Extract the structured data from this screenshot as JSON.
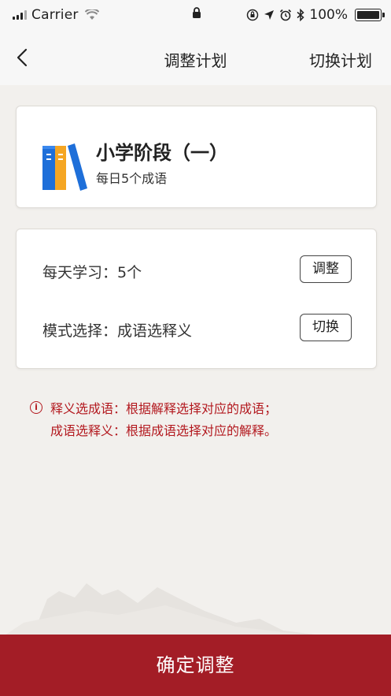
{
  "status_bar": {
    "carrier": "Carrier",
    "battery": "100%",
    "icons": [
      "signal-icon",
      "wifi-icon",
      "lock-icon",
      "orientation-lock-icon",
      "location-icon",
      "alarm-icon",
      "bluetooth-icon",
      "battery-icon"
    ]
  },
  "nav": {
    "back_icon": "chevron-left-icon",
    "title": "调整计划",
    "right_action": "切换计划"
  },
  "plan": {
    "icon": "books-icon",
    "title": "小学阶段（一）",
    "subtitle": "每日5个成语"
  },
  "settings": {
    "daily": {
      "label": "每天学习：5个",
      "button": "调整"
    },
    "mode": {
      "label": "模式选择：成语选释义",
      "button": "切换"
    }
  },
  "info": {
    "icon": "info-icon",
    "line1": "释义选成语：根据解释选择对应的成语；",
    "line2": "成语选释义：根据成语选择对应的解释。"
  },
  "confirm_button": "确定调整",
  "colors": {
    "accent": "#a31d26",
    "info_text": "#b3191f",
    "background": "#f2f0ed"
  }
}
